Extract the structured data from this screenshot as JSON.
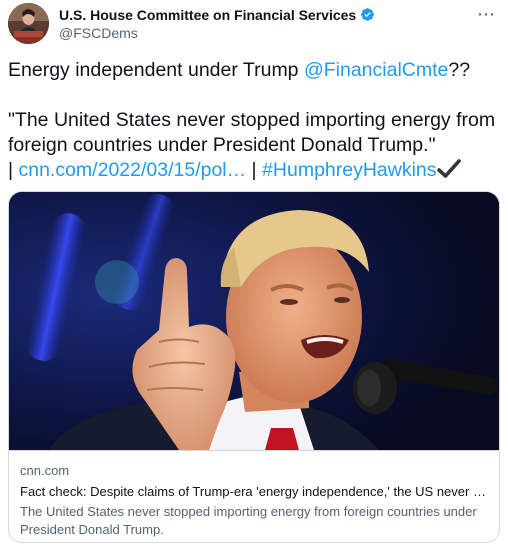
{
  "account": {
    "name": "U.S. House Committee on Financial Services",
    "handle": "@FSCDems",
    "verified_color": "#1d9bf0"
  },
  "more_icon": "more-horizontal-icon",
  "tweet": {
    "line1_text": "Energy independent under Trump ",
    "line1_mention": "@FinancialCmte",
    "line1_suffix": "??",
    "quote": "\"The United States never stopped importing energy from foreign countries under President Donald Trump.\"",
    "sep1": "| ",
    "url": "cnn.com/2022/03/15/pol…",
    "sep2": " | ",
    "hashtag": "#HumphreyHawkins",
    "check_icon": "heavy-check-mark-icon"
  },
  "card": {
    "domain": "cnn.com",
    "title": "Fact check: Despite claims of Trump-era 'energy independence,' the US never …",
    "description": "The United States never stopped importing energy from foreign countries under President Donald Trump."
  },
  "colors": {
    "link": "#1d9bf0",
    "text": "#0f1419",
    "secondary": "#536471",
    "border": "#cfd9de"
  }
}
